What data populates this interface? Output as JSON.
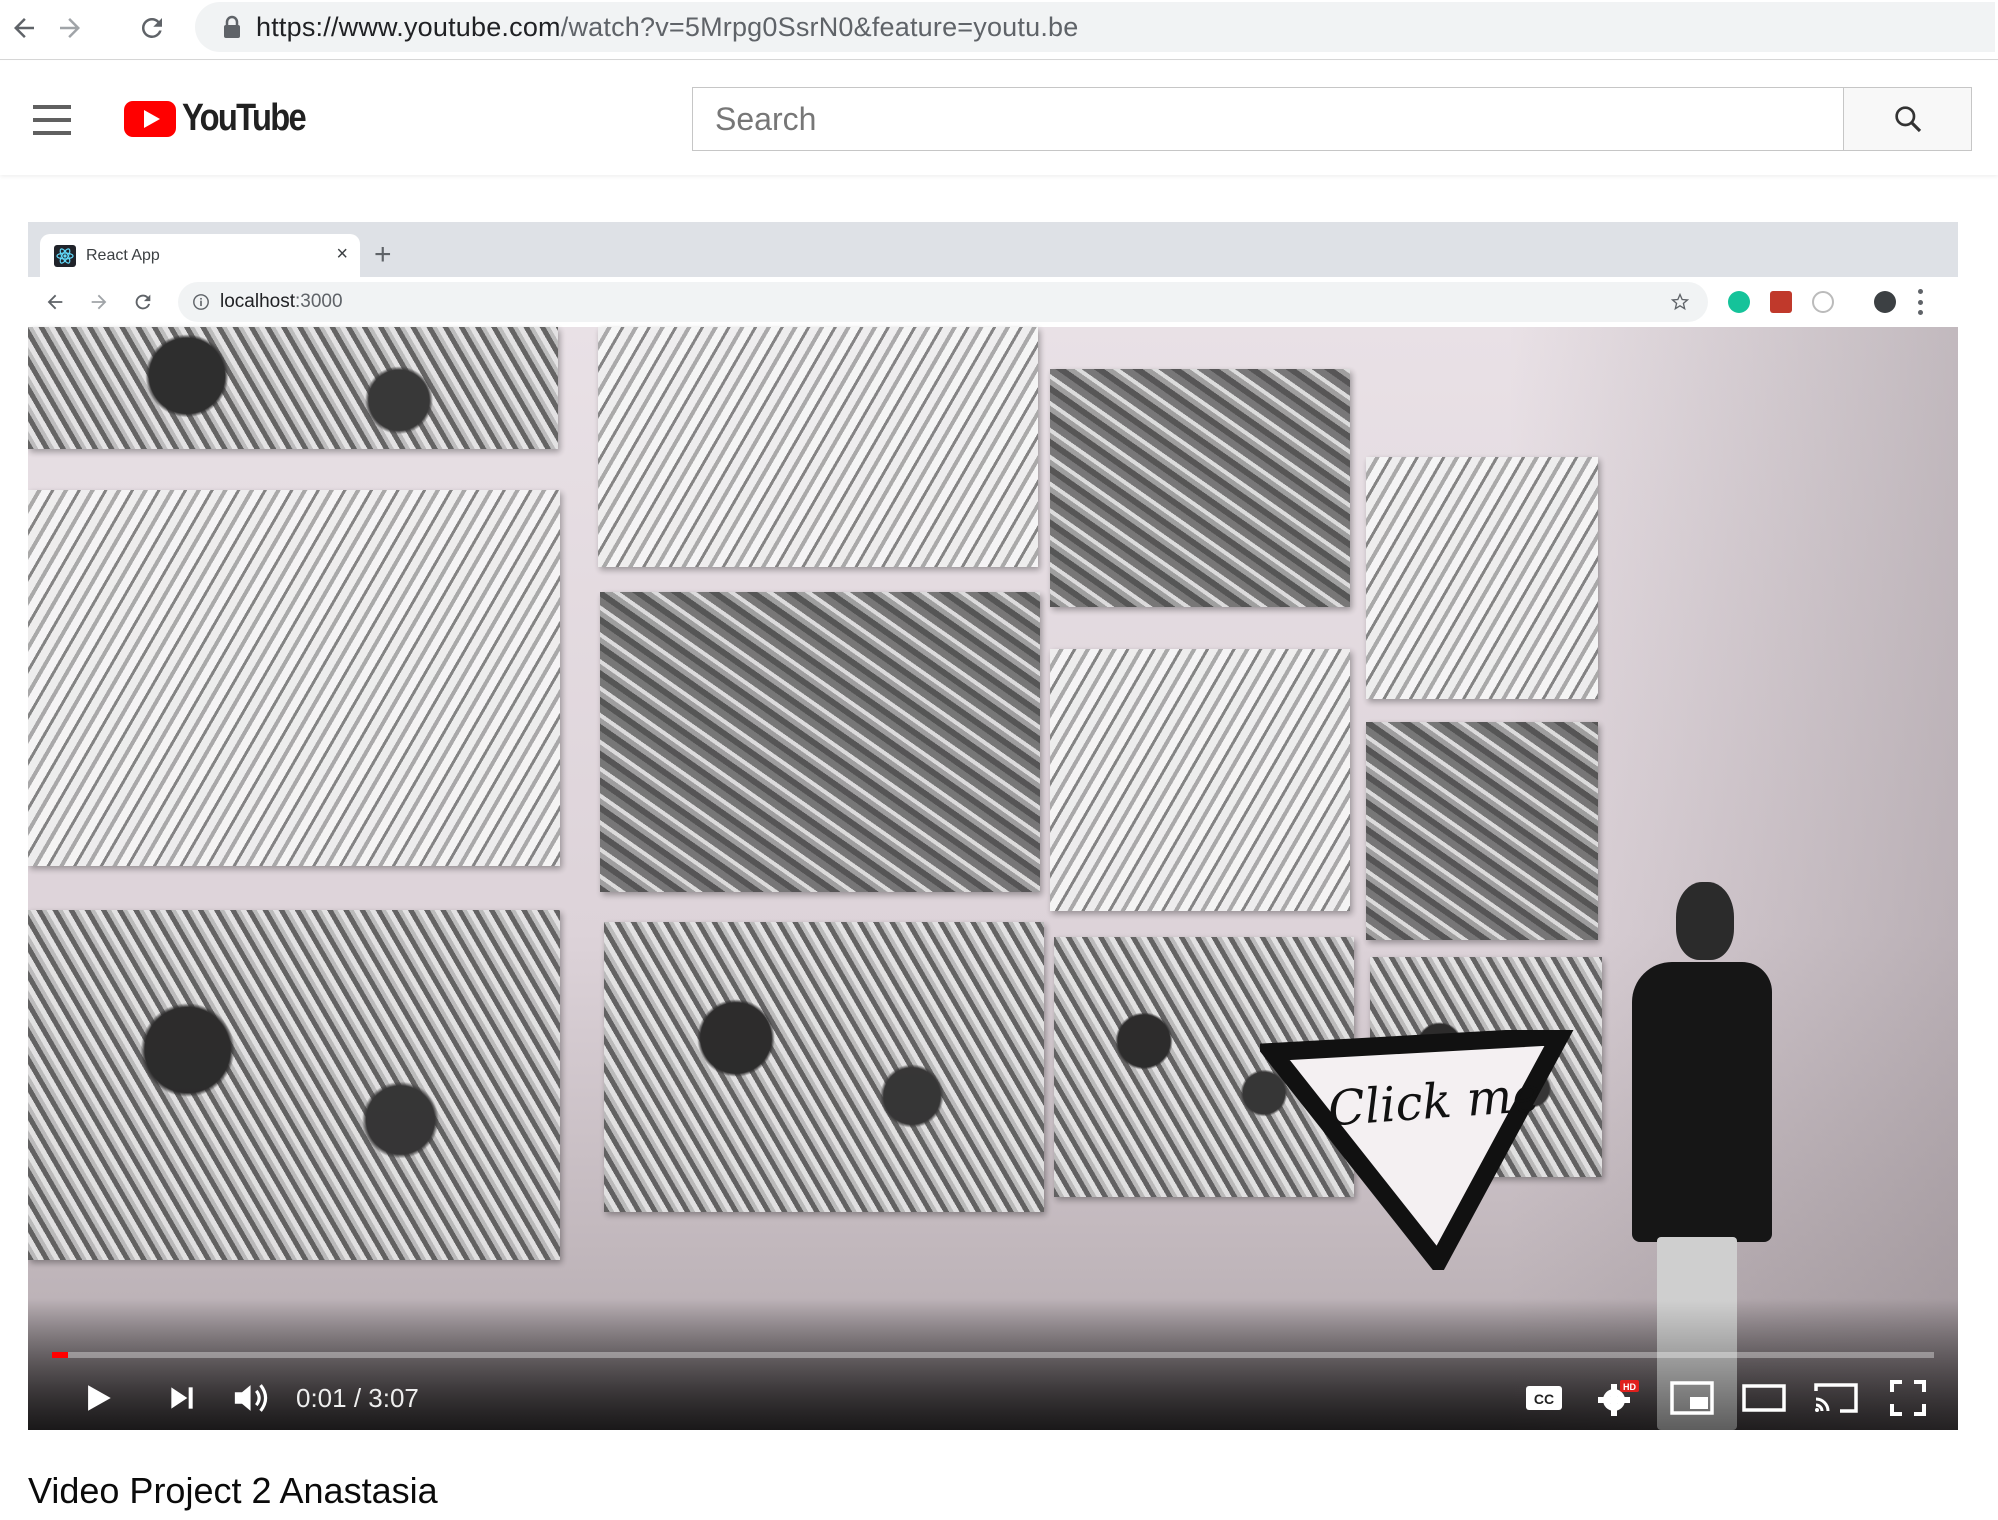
{
  "browser": {
    "url_main": "https://www.youtube.com",
    "url_rest": "/watch?v=5Mrpg0SsrN0&feature=youtu.be"
  },
  "youtube": {
    "logo_text": "YouTube",
    "search_placeholder": "Search",
    "brand_color": "#ff0000"
  },
  "recorded_browser": {
    "tab_title": "React App",
    "tab_close": "×",
    "new_tab": "+",
    "url_host": "localhost",
    "url_port": ":3000"
  },
  "video": {
    "overlay_text": "Click me",
    "current_time": "0:01",
    "duration": "3:07",
    "progress_fraction": 0.006,
    "title": "Video Project 2 Anastasia"
  }
}
